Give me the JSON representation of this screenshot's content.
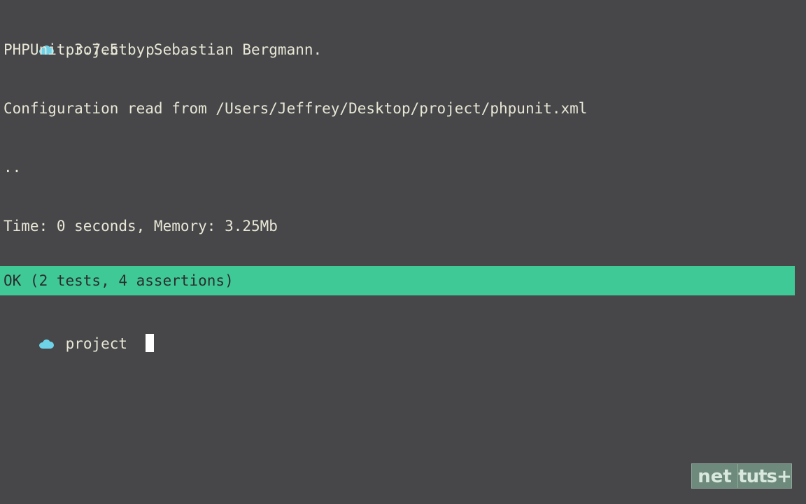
{
  "colors": {
    "background": "#474749",
    "text": "#e8e6d6",
    "prompt_icon": "#6fd3e8",
    "success_bar": "#3ec996",
    "cursor": "#ffffff"
  },
  "prompt_icon": "cloud-icon",
  "lines": {
    "prompt1_dir": "project",
    "prompt1_cmd": "p",
    "version": "PHPUnit 3.7.5 by Sebastian Bergmann.",
    "config": "Configuration read from /Users/Jeffrey/Desktop/project/phpunit.xml",
    "progress": "..",
    "time": "Time: 0 seconds, Memory: 3.25Mb",
    "result": "OK (2 tests, 4 assertions)",
    "prompt2_dir": "project"
  },
  "watermark": {
    "left": "net",
    "right": "tuts+"
  }
}
